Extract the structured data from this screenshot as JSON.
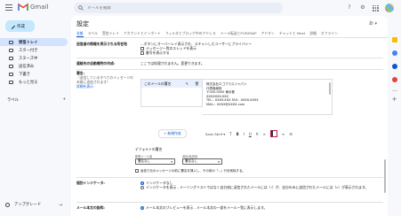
{
  "app": {
    "name": "Gmail"
  },
  "search": {
    "placeholder": "メールを検索"
  },
  "sidebar": {
    "compose_label": "作成",
    "items": [
      {
        "label": "受信トレイ",
        "count": "",
        "active": true
      },
      {
        "label": "スター付き",
        "count": ""
      },
      {
        "label": "スヌーズ中",
        "count": ""
      },
      {
        "label": "送信済み",
        "count": ""
      },
      {
        "label": "下書き",
        "count": ""
      },
      {
        "label": "もっと見る",
        "count": ""
      }
    ],
    "labels_header": "ラベル",
    "upgrade_label": "アップグレード"
  },
  "settings": {
    "title": "設定",
    "tabs": [
      "全般",
      "ラベル",
      "受信トレイ",
      "アカウントとインポート",
      "フィルタとブロック中のアドレス",
      "メール転送とPOP/IMAP",
      "アドオン",
      "チャットと Meet",
      "詳細",
      "オフライン"
    ],
    "active_tab": 0,
    "rows": {
      "top_text_1": "…ボタンにオーバーレイ表示され、スキャンしたユーザーにプライバシー",
      "top_text_2": "…（写真付き）を表示する",
      "prev_row_label": "送信者の情報を表示される所在地",
      "prev_row_opt_1": "メッセージ一覧のスレッドを表示",
      "prev_row_opt_2": "番号を表示する",
      "contacts_label": "連絡先の自動補完の作成:",
      "contacts_text": "ここでは処理されません。変更できます。",
      "signature_label": "署名:",
      "signature_sub": "（送信しているすべてのメッセージの末尾に追加されます）",
      "signature_link": "詳細を表示"
    },
    "signature": {
      "name": "このメールの署名",
      "text_lines": [
        "株式会社ロゴプラスジャパン",
        "代表取締役",
        "〒000-0000 東京都",
        "XXXXXXX-XXX",
        "TEL：XXXX-XXX FAX：XXXX-XXXX",
        "MAIL：XXXX@XXXX.com"
      ],
      "font_label": "Sans Serif",
      "create_new": "+ 新規作成"
    },
    "defaults": {
      "title": "デフォルトの署名",
      "new_mail_label": "新規メール用",
      "new_mail_value": "署名なし",
      "reply_label": "返信/転送用",
      "reply_value": "署名なし",
      "insert_before": "返信で元のメッセージの前に署名を挿入し、その前の「--」行を削除する。"
    },
    "personal": {
      "label": "個別インジケータ:",
      "opt_none": "インジケータなし",
      "opt_show": "インジケータを表示 - メーリングリストではなく自分宛に送信されたメールには（›）が、自分のみに送信されたメールには（»）が表示されます。"
    },
    "snippets": {
      "label": "メール本文の抜粋:",
      "opt_show": "メール本文のプレビューを表示 - メール本文の一部をメール一覧に表示します。"
    }
  },
  "colors": {
    "accent": "#0b57d0",
    "sidebar_active": "#d3e3fd",
    "compose_bg": "#c2e7ff",
    "highlight_box": "#c2185b"
  }
}
